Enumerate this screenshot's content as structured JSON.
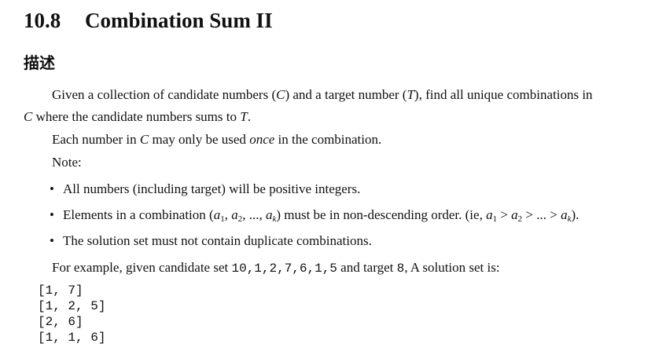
{
  "section": {
    "number": "10.8",
    "title": "Combination Sum II"
  },
  "heading": "描述",
  "p1": {
    "a": "Given a collection of candidate numbers (",
    "C": "C",
    "b": ") and a target number (",
    "T": "T",
    "c": "), find all unique combinations in",
    "d": " where the candidate numbers sums to ",
    "e": "."
  },
  "p2": {
    "a": "Each number in ",
    "C": "C",
    "b": " may only be used ",
    "once": "once",
    "c": " in the combination."
  },
  "note": "Note:",
  "bullets": {
    "b1": "All numbers (including target) will be positive integers.",
    "b2": {
      "a": "Elements in a combination (",
      "a1": "a",
      "s1": "1",
      "comma": ", ",
      "a2": "a",
      "s2": "2",
      "ell": ", ..., ",
      "ak": "a",
      "sk": "k",
      "b": ") must be in non-descending order. (ie, ",
      "gt": " > ",
      "dots": " ... ",
      "e": ")."
    },
    "b3": "The solution set must not contain duplicate combinations."
  },
  "example": {
    "a": "For example, given candidate set ",
    "set": "10,1,2,7,6,1,5",
    "b": " and target ",
    "target": "8",
    "c": ", A solution set is:"
  },
  "solutions": [
    "[1, 7]",
    "[1, 2, 5]",
    "[2, 6]",
    "[1, 1, 6]"
  ]
}
